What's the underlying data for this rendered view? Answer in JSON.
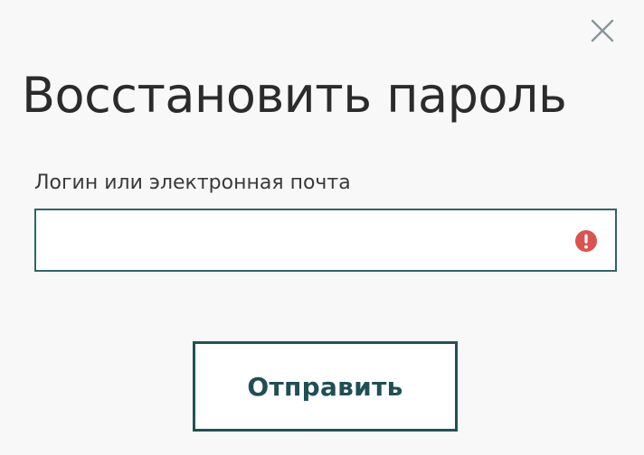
{
  "dialog": {
    "title": "Восстановить пароль",
    "close_icon": "close-icon",
    "field": {
      "label": "Логин или электронная почта",
      "value": "",
      "placeholder": "",
      "status_icon": "error-icon",
      "status_color": "#d9534f"
    },
    "submit_label": "Отправить"
  },
  "colors": {
    "border": "#2f6468",
    "button_border": "#1f5257",
    "button_text": "#1f4f55",
    "title_text": "#2b2b2b"
  }
}
